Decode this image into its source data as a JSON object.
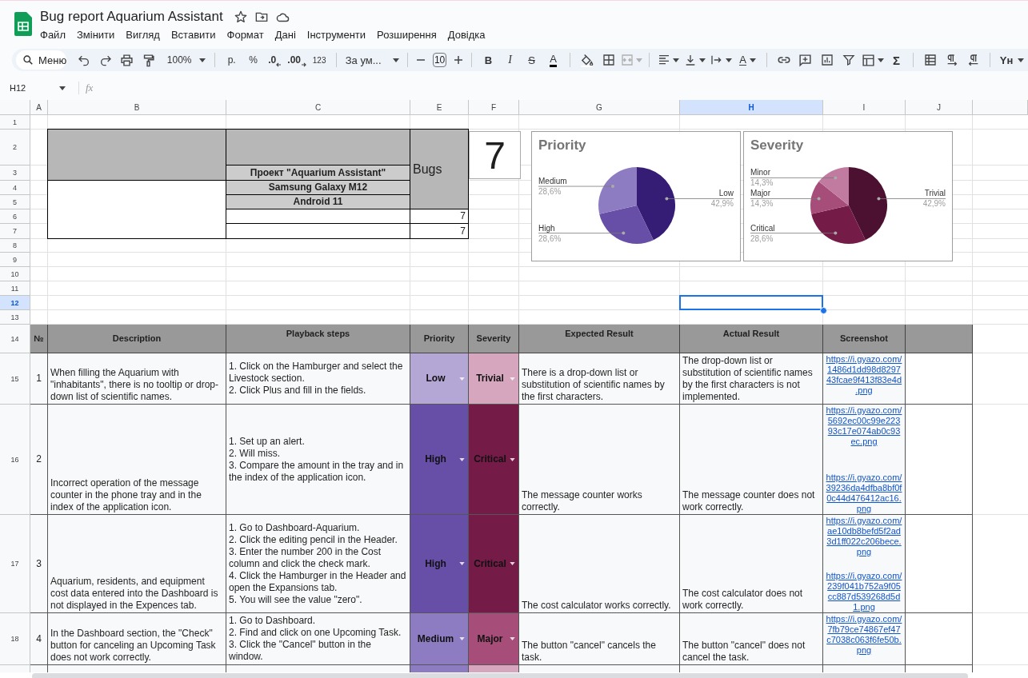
{
  "document": {
    "title": "Bug report Aquarium Assistant"
  },
  "menu": [
    "Файл",
    "Змінити",
    "Вигляд",
    "Вставити",
    "Формат",
    "Дані",
    "Інструменти",
    "Розширення",
    "Довідка"
  ],
  "toolbar": {
    "search": "Меню",
    "zoom": "100%",
    "currency": "р.",
    "percent": "%",
    "decrease_decimals": ".0",
    "increase_decimals": ".00",
    "number_format": "123",
    "font": "За ум...",
    "font_size": "10",
    "bold": "B",
    "italic": "I",
    "strikethrough": "S",
    "text_color": "A",
    "merge_cells": {
      "disabled": true
    },
    "text_rotation": "A",
    "functions": "Σ",
    "input_tools": "Yн"
  },
  "formula_bar": {
    "name_box": "H12",
    "function_label": "fx"
  },
  "columns": [
    {
      "label": "A",
      "selected": false
    },
    {
      "label": "B",
      "selected": false
    },
    {
      "label": "C",
      "selected": false
    },
    {
      "label": "E",
      "selected": false
    },
    {
      "label": "F",
      "selected": false
    },
    {
      "label": "G",
      "selected": false
    },
    {
      "label": "H",
      "selected": true
    },
    {
      "label": "I",
      "selected": false
    },
    {
      "label": "J",
      "selected": false
    }
  ],
  "row_headers": [
    {
      "label": "1",
      "selected": false
    },
    {
      "label": "2",
      "selected": false
    },
    {
      "label": "3",
      "selected": false
    },
    {
      "label": "4",
      "selected": false
    },
    {
      "label": "5",
      "selected": false
    },
    {
      "label": "6",
      "selected": false
    },
    {
      "label": "7",
      "selected": false
    },
    {
      "label": "8",
      "selected": false
    },
    {
      "label": "9",
      "selected": false
    },
    {
      "label": "10",
      "selected": false
    },
    {
      "label": "11",
      "selected": false
    },
    {
      "label": "12",
      "selected": true
    },
    {
      "label": "13",
      "selected": false
    },
    {
      "label": "14",
      "selected": false
    },
    {
      "label": "15",
      "selected": false
    },
    {
      "label": "16",
      "selected": false
    },
    {
      "label": "17",
      "selected": false
    },
    {
      "label": "18",
      "selected": false
    }
  ],
  "summary": {
    "project": "Проект \"Aquarium Assistant\"",
    "device": "Samsung Galaxy M12",
    "os": "Android 11",
    "bugs_label": "Bugs",
    "count_1": "7",
    "count_2": "7",
    "big_count": "7"
  },
  "charts": [
    {
      "chart_data": {
        "type": "pie",
        "title": "Priority",
        "categories": [
          "Low",
          "High",
          "Medium"
        ],
        "values": [
          42.9,
          28.6,
          28.6
        ],
        "colors": [
          "#351c75",
          "#674ea7",
          "#8e7cc3"
        ],
        "value_labels": [
          "42,9%",
          "28,6%",
          "28,6%"
        ]
      }
    },
    {
      "chart_data": {
        "type": "pie",
        "title": "Severity",
        "categories": [
          "Trivial",
          "Critical",
          "Major",
          "Minor"
        ],
        "values": [
          42.9,
          28.6,
          14.3,
          14.3
        ],
        "colors": [
          "#4c1130",
          "#741b47",
          "#a64d79",
          "#c27ba0"
        ],
        "value_labels": [
          "42,9%",
          "28,6%",
          "14,3%",
          "14,3%"
        ]
      }
    }
  ],
  "table": {
    "columns": [
      "№",
      "Description",
      "Playback steps",
      "Priority",
      "Severity",
      "Expected Result",
      "Actual Result",
      "Screenshot"
    ],
    "rows": [
      {
        "number": "1",
        "description": "When filling the Aquarium with \"inhabitants\", there is no tooltip or drop-down list of scientific names.",
        "steps": "1. Click on the Hamburger and select the Livestock section.\n2. Click Plus and fill in the fields.",
        "priority": {
          "label": "Low",
          "color": "#b4a7d6"
        },
        "severity": {
          "label": "Trivial",
          "color": "#d5a6bd"
        },
        "expected": "There is a drop-down list or substitution of scientific names by the first characters.",
        "actual": "The drop-down list or substitution of scientific names by the first characters is not implemented.",
        "links": [
          "https://i.gyazo.com/1486d1dd98d829743fcae9f413f83e4d.png"
        ]
      },
      {
        "number": "2",
        "description": "Incorrect operation of the message counter in the phone tray and in the index of the application icon.",
        "steps": "1. Set up an alert.\n2. Will miss.\n3. Compare the amount in the tray and in the index of the application icon.",
        "priority": {
          "label": "High",
          "color": "#674ea7"
        },
        "severity": {
          "label": "Critical",
          "color": "#741b47"
        },
        "expected": "The message counter works correctly.",
        "actual": "The message counter does not work correctly.",
        "links": [
          "https://i.gyazo.com/5692ec00c99e22393c17e074ab0c93ec.png",
          "https://i.gyazo.com/39236da4dfba8bf0f0c44d476412ac16.png"
        ]
      },
      {
        "number": "3",
        "description": "Aquarium, residents, and equipment cost data entered into the Dashboard is not displayed in the Expences tab.",
        "steps": "1. Go to Dashboard-Aquarium.\n2. Click the editing pencil in the Header.\n3. Enter the number 200 in the Cost column and click the check mark.\n4. Click the Hamburger in the Header and open the Expansions tab.\n5. You will see the value \"zero\".",
        "priority": {
          "label": "High",
          "color": "#674ea7"
        },
        "severity": {
          "label": "Critical",
          "color": "#741b47"
        },
        "expected": "The cost calculator works correctly.",
        "actual": "The cost calculator does not work correctly.",
        "links": [
          "https://i.gyazo.com/ae10db8befd5f2ad3d1ff022c206bece.png",
          "https://i.gyazo.com/239f041b752a9f05cc887d539268d5d1.png"
        ]
      },
      {
        "number": "4",
        "description": "In the Dashboard section, the \"Check\" button for canceling an Upcoming Task does not work correctly.",
        "steps": "1. Go to Dashboard.\n2. Find and click on one Upcoming Task.\n3. Click the \"Cancel\" button in the window.",
        "priority": {
          "label": "Medium",
          "color": "#8e7cc3"
        },
        "severity": {
          "label": "Major",
          "color": "#a64d79"
        },
        "expected": "The button \"cancel\" cancels the task.",
        "actual": "The button \"cancel\" does not cancel the task.",
        "links": [
          "https://i.gyazo.com/7fb79ce74867ef47c7038c063f6fe50b.png"
        ]
      },
      {
        "priority": {
          "color": "#8e7cc3"
        },
        "severity": {
          "color": "#d5a6bd"
        }
      }
    ]
  }
}
